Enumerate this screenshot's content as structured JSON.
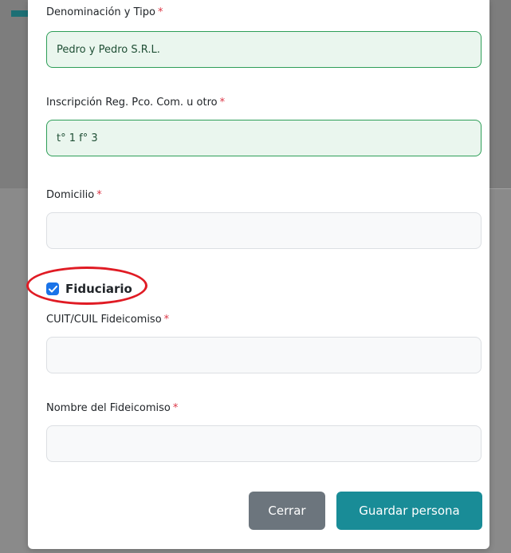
{
  "form": {
    "required_mark": "*",
    "denominacion": {
      "label": "Denominación y Tipo",
      "value": "Pedro y Pedro S.R.L."
    },
    "inscripcion": {
      "label": "Inscripción Reg. Pco. Com. u otro",
      "value": "t° 1 f° 3"
    },
    "domicilio": {
      "label": "Domicilio",
      "value": ""
    },
    "fiduciario": {
      "label": "Fiduciario",
      "checked": true
    },
    "cuit_fideicomiso": {
      "label": "CUIT/CUIL Fideicomiso",
      "value": ""
    },
    "nombre_fideicomiso": {
      "label": "Nombre del Fideicomiso",
      "value": ""
    }
  },
  "buttons": {
    "close_label": "Cerrar",
    "save_label": "Guardar persona"
  },
  "colors": {
    "primary": "#198c97",
    "secondary": "#6c757d",
    "valid_border": "#2e9e58",
    "required": "#dc3545",
    "checkbox": "#1a73e8",
    "annotation": "#e01b24"
  }
}
